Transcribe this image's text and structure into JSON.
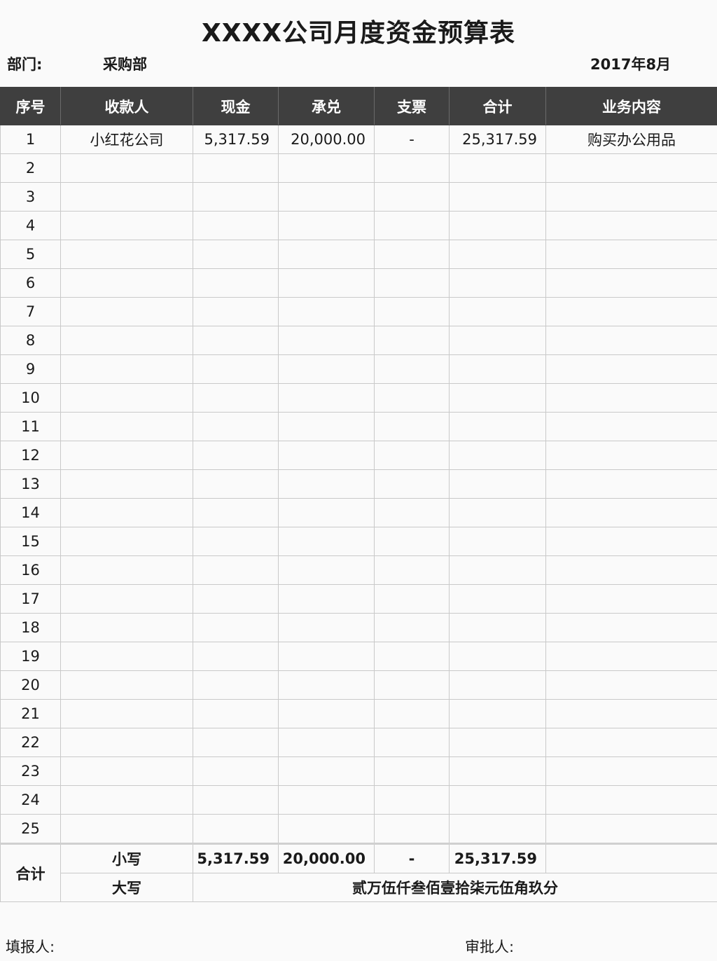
{
  "title": "XXXX公司月度资金预算表",
  "department": {
    "label": "部门:",
    "value": "采购部"
  },
  "period": "2017年8月",
  "columns": [
    "序号",
    "收款人",
    "现金",
    "承兑",
    "支票",
    "合计",
    "业务内容"
  ],
  "rows": [
    {
      "no": "1",
      "payee": "小红花公司",
      "cash": "5,317.59",
      "acceptance": "20,000.00",
      "cheque": "-",
      "total": "25,317.59",
      "business": "购买办公用品"
    },
    {
      "no": "2",
      "payee": "",
      "cash": "",
      "acceptance": "",
      "cheque": "",
      "total": "",
      "business": ""
    },
    {
      "no": "3",
      "payee": "",
      "cash": "",
      "acceptance": "",
      "cheque": "",
      "total": "",
      "business": ""
    },
    {
      "no": "4",
      "payee": "",
      "cash": "",
      "acceptance": "",
      "cheque": "",
      "total": "",
      "business": ""
    },
    {
      "no": "5",
      "payee": "",
      "cash": "",
      "acceptance": "",
      "cheque": "",
      "total": "",
      "business": ""
    },
    {
      "no": "6",
      "payee": "",
      "cash": "",
      "acceptance": "",
      "cheque": "",
      "total": "",
      "business": ""
    },
    {
      "no": "7",
      "payee": "",
      "cash": "",
      "acceptance": "",
      "cheque": "",
      "total": "",
      "business": ""
    },
    {
      "no": "8",
      "payee": "",
      "cash": "",
      "acceptance": "",
      "cheque": "",
      "total": "",
      "business": ""
    },
    {
      "no": "9",
      "payee": "",
      "cash": "",
      "acceptance": "",
      "cheque": "",
      "total": "",
      "business": ""
    },
    {
      "no": "10",
      "payee": "",
      "cash": "",
      "acceptance": "",
      "cheque": "",
      "total": "",
      "business": ""
    },
    {
      "no": "11",
      "payee": "",
      "cash": "",
      "acceptance": "",
      "cheque": "",
      "total": "",
      "business": ""
    },
    {
      "no": "12",
      "payee": "",
      "cash": "",
      "acceptance": "",
      "cheque": "",
      "total": "",
      "business": ""
    },
    {
      "no": "13",
      "payee": "",
      "cash": "",
      "acceptance": "",
      "cheque": "",
      "total": "",
      "business": ""
    },
    {
      "no": "14",
      "payee": "",
      "cash": "",
      "acceptance": "",
      "cheque": "",
      "total": "",
      "business": ""
    },
    {
      "no": "15",
      "payee": "",
      "cash": "",
      "acceptance": "",
      "cheque": "",
      "total": "",
      "business": ""
    },
    {
      "no": "16",
      "payee": "",
      "cash": "",
      "acceptance": "",
      "cheque": "",
      "total": "",
      "business": ""
    },
    {
      "no": "17",
      "payee": "",
      "cash": "",
      "acceptance": "",
      "cheque": "",
      "total": "",
      "business": ""
    },
    {
      "no": "18",
      "payee": "",
      "cash": "",
      "acceptance": "",
      "cheque": "",
      "total": "",
      "business": ""
    },
    {
      "no": "19",
      "payee": "",
      "cash": "",
      "acceptance": "",
      "cheque": "",
      "total": "",
      "business": ""
    },
    {
      "no": "20",
      "payee": "",
      "cash": "",
      "acceptance": "",
      "cheque": "",
      "total": "",
      "business": ""
    },
    {
      "no": "21",
      "payee": "",
      "cash": "",
      "acceptance": "",
      "cheque": "",
      "total": "",
      "business": ""
    },
    {
      "no": "22",
      "payee": "",
      "cash": "",
      "acceptance": "",
      "cheque": "",
      "total": "",
      "business": ""
    },
    {
      "no": "23",
      "payee": "",
      "cash": "",
      "acceptance": "",
      "cheque": "",
      "total": "",
      "business": ""
    },
    {
      "no": "24",
      "payee": "",
      "cash": "",
      "acceptance": "",
      "cheque": "",
      "total": "",
      "business": ""
    },
    {
      "no": "25",
      "payee": "",
      "cash": "",
      "acceptance": "",
      "cheque": "",
      "total": "",
      "business": ""
    }
  ],
  "totals": {
    "label": "合计",
    "lowercase_label": "小写",
    "cash": "5,317.59",
    "acceptance": "20,000.00",
    "cheque": "-",
    "total": "25,317.59",
    "uppercase_label": "大写",
    "uppercase_amount": "贰万伍仟叁佰壹拾柒元伍角玖分"
  },
  "footer": {
    "filler_label": "填报人:",
    "approver_label": "审批人:"
  }
}
